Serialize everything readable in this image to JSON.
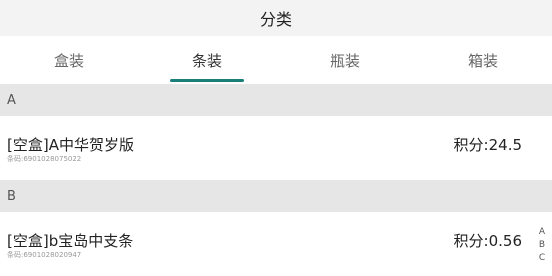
{
  "header": {
    "title": "分类"
  },
  "tabs": [
    {
      "label": "盒装",
      "active": false
    },
    {
      "label": "条装",
      "active": true
    },
    {
      "label": "瓶装",
      "active": false
    },
    {
      "label": "箱装",
      "active": false
    }
  ],
  "sections": [
    {
      "letter": "A",
      "items": [
        {
          "name": "[空盒]A中华贺岁版",
          "barcode": "条码:6901028075022",
          "points": "积分:24.5"
        }
      ]
    },
    {
      "letter": "B",
      "items": [
        {
          "name": "[空盒]b宝岛中支条",
          "barcode": "条码:6901028020947",
          "points": "积分:0.56"
        }
      ]
    }
  ],
  "index_bar": [
    "A",
    "B",
    "C"
  ],
  "colors": {
    "accent": "#1a7f7a",
    "section_bg": "#e6e6e6",
    "header_bg": "#f3f3f3"
  }
}
